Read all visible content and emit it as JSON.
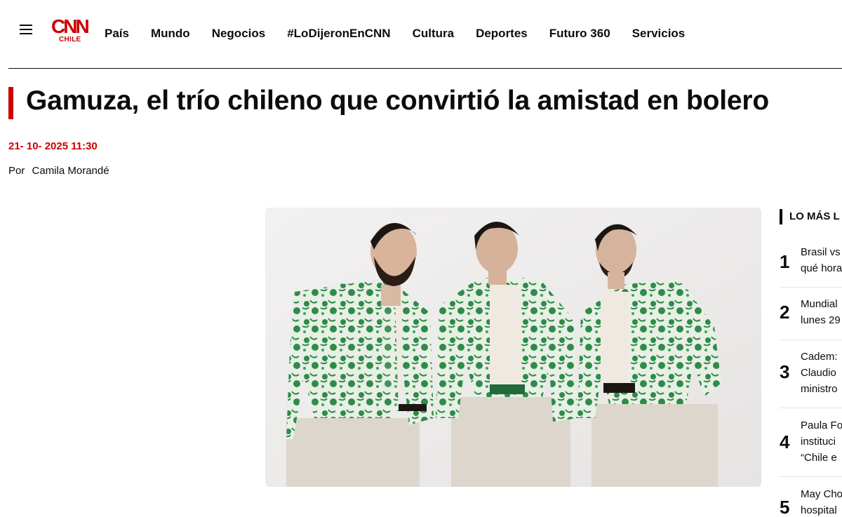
{
  "header": {
    "logo_text": "CNN",
    "logo_sub": "CHILE",
    "nav": [
      "País",
      "Mundo",
      "Negocios",
      "#LoDijeronEnCNN",
      "Cultura",
      "Deportes",
      "Futuro 360",
      "Servicios"
    ]
  },
  "article": {
    "title": "Gamuza, el trío chileno que convirtió la amistad en bolero",
    "date": "21- 10- 2025 11:30",
    "by_label": "Por",
    "author": "Camila Morandé",
    "image_subject": "three-men-floral-green-jackets"
  },
  "sidebar": {
    "title": "LO MÁS L",
    "items": [
      {
        "num": "1",
        "lines": [
          "Brasil vs",
          "qué hora"
        ]
      },
      {
        "num": "2",
        "lines": [
          "Mundial",
          "lunes 29"
        ]
      },
      {
        "num": "3",
        "lines": [
          "Cadem:",
          "Claudio",
          "ministro"
        ]
      },
      {
        "num": "4",
        "lines": [
          "Paula Fo",
          "instituci",
          "“Chile e"
        ]
      },
      {
        "num": "5",
        "lines": [
          "May Cho",
          "hospital"
        ]
      }
    ]
  },
  "colors": {
    "accent": "#cc0000",
    "text": "#0c0c0c",
    "jacket_green": "#2e8b4a"
  }
}
